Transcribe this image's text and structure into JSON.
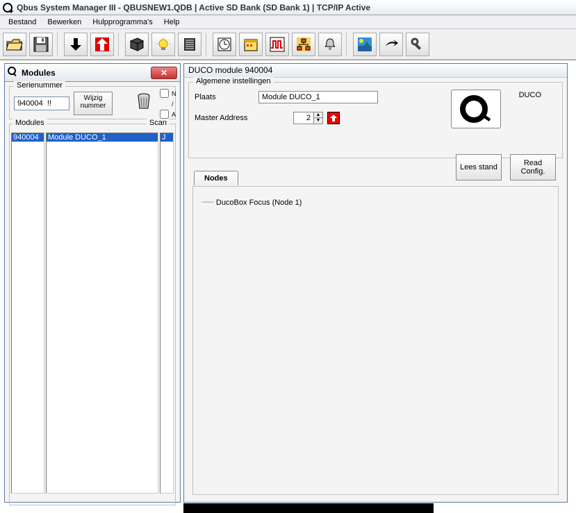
{
  "title": "Qbus System Manager III - QBUSNEW1.QDB | Active SD Bank (SD Bank 1) | TCP/IP Active",
  "menu": {
    "bestand": "Bestand",
    "bewerken": "Bewerken",
    "hulp": "Hulpprogramma's",
    "help": "Help"
  },
  "modules_window": {
    "title": "Modules",
    "serienummer_label": "Serienummer",
    "serienummer_value": "940004  !!",
    "wijzig_label": "Wijzig nummer",
    "na_n": "N",
    "na_divider": "/",
    "na_a": "A",
    "modules_label": "Modules",
    "scan_label": "Scan",
    "rows": [
      {
        "id": "940004",
        "name": "Module DUCO_1",
        "scan": "J"
      }
    ]
  },
  "duco_panel": {
    "title": "DUCO module 940004",
    "alg_label": "Algemene instellingen",
    "plaats_label": "Plaats",
    "plaats_value": "Module DUCO_1",
    "master_label": "Master Address",
    "master_value": "2",
    "brand_label": "DUCO",
    "lees_stand": "Lees stand",
    "read_config": "Read Config.",
    "tab_nodes": "Nodes",
    "node1": "DucoBox Focus (Node 1)"
  }
}
